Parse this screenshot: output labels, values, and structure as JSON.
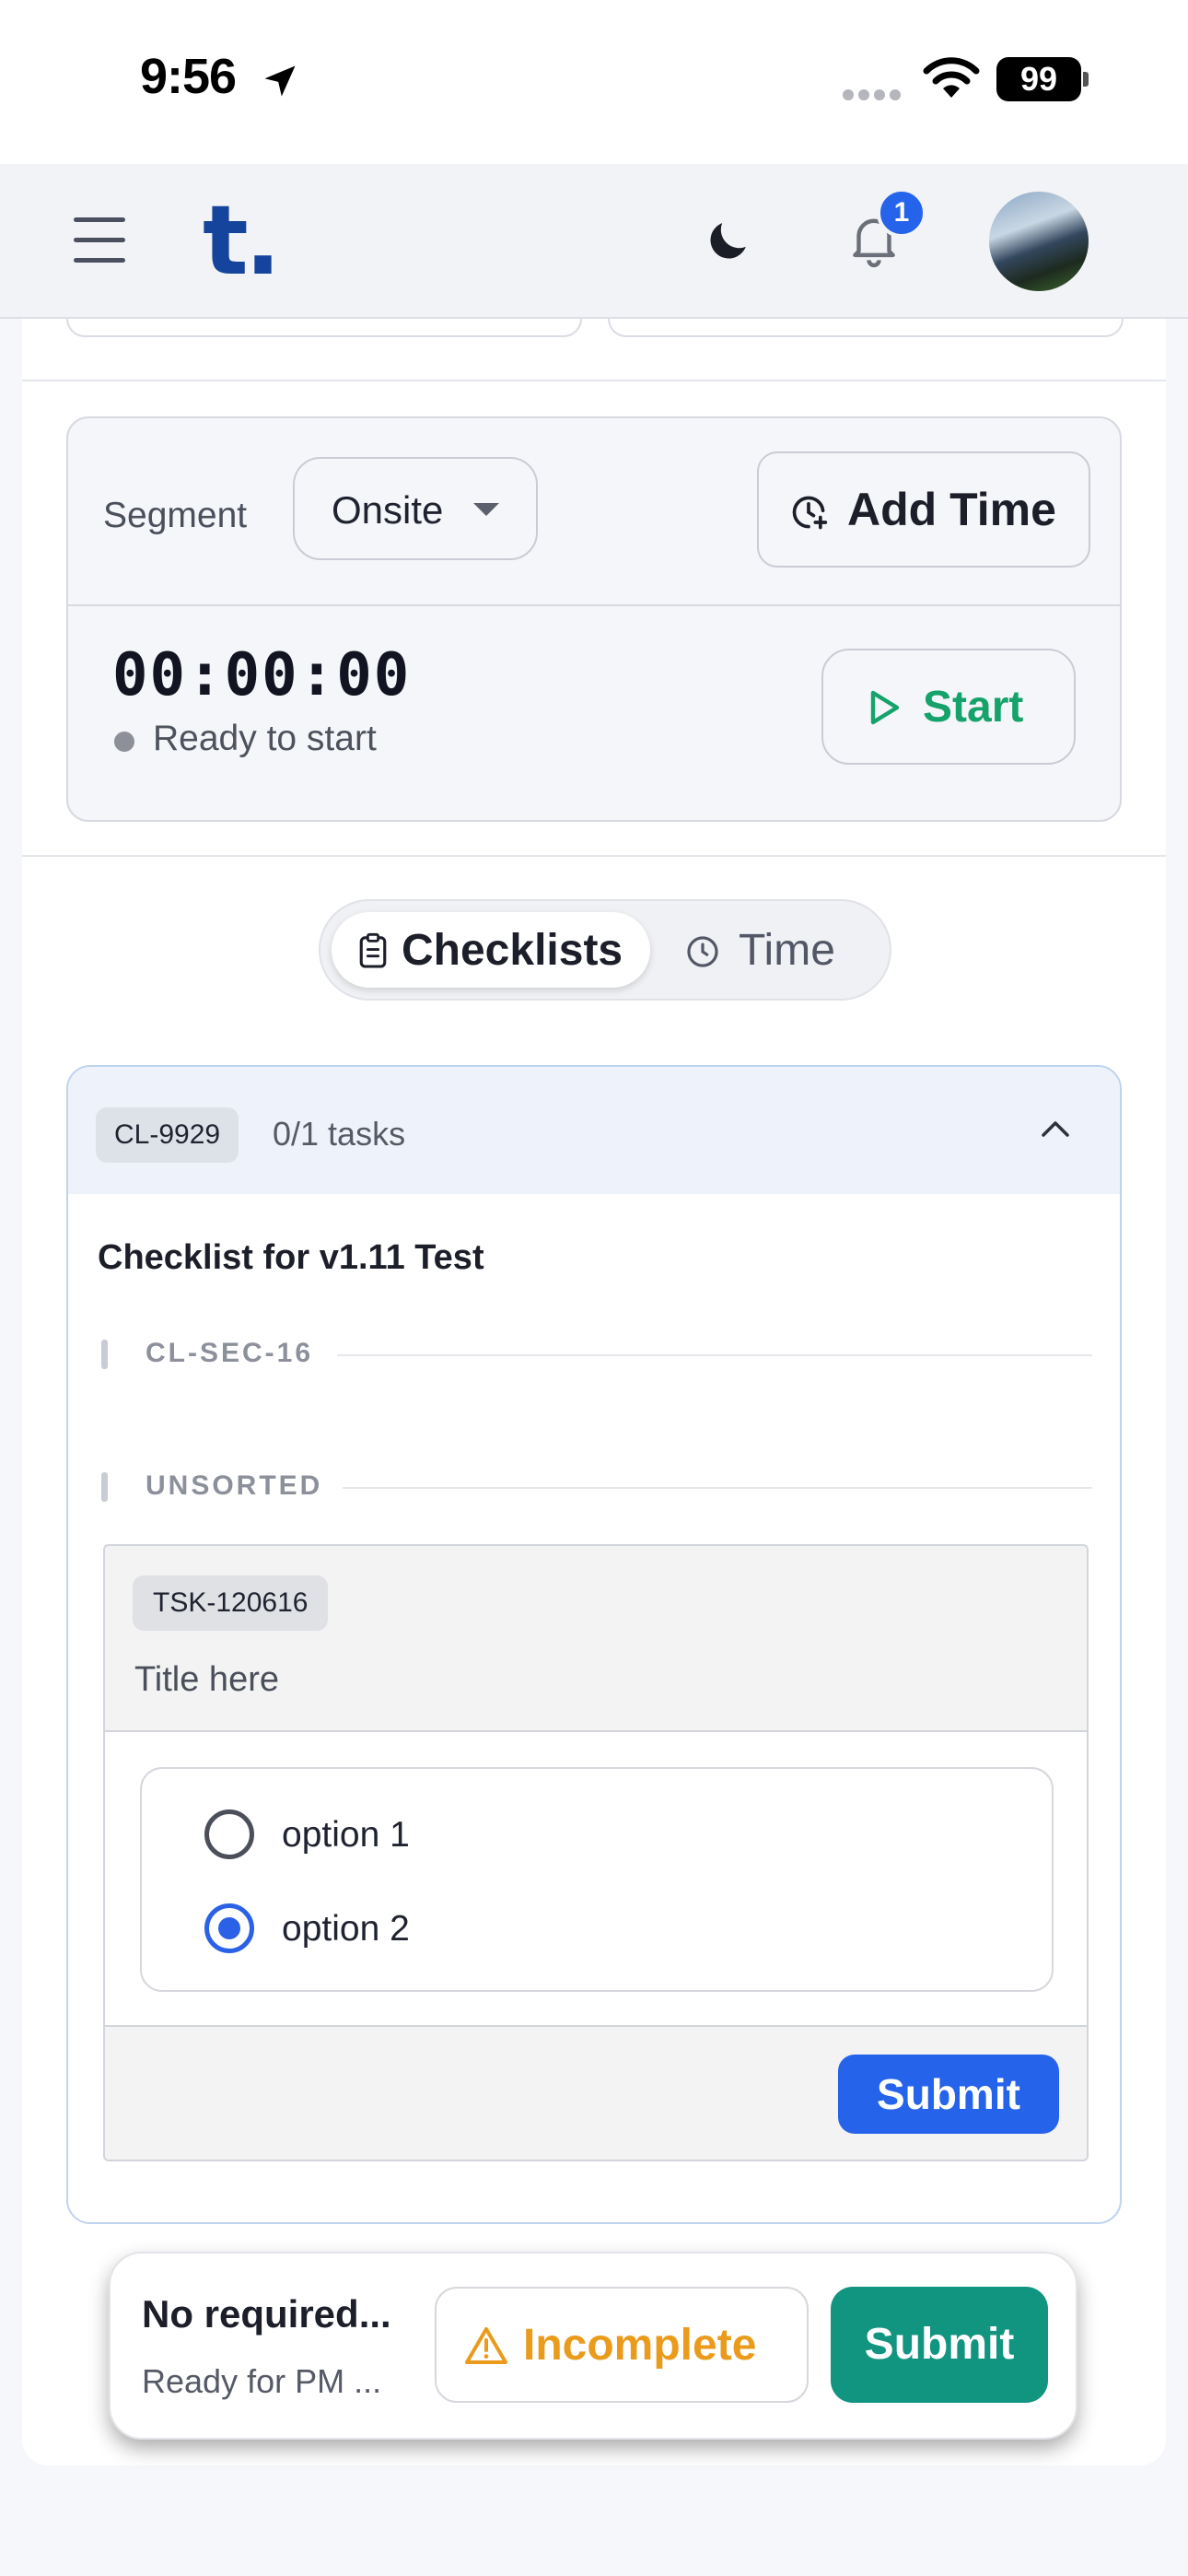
{
  "status_bar": {
    "time": "9:56",
    "battery": "99",
    "icons": [
      "location-arrow-icon",
      "signal-dots-icon",
      "wifi-icon",
      "battery-icon"
    ]
  },
  "app_bar": {
    "logo": "t.",
    "notification_count": "1",
    "icons": [
      "hamburger-menu-icon",
      "moon-icon",
      "bell-icon"
    ]
  },
  "timer": {
    "segment_label": "Segment",
    "segment_value": "Onsite",
    "add_time_label": "Add Time",
    "elapsed": "00:00:00",
    "status": "Ready to start",
    "start_label": "Start"
  },
  "tabs": [
    {
      "label": "Checklists",
      "icon": "clipboard-icon",
      "active": true
    },
    {
      "label": "Time",
      "icon": "clock-icon",
      "active": false
    }
  ],
  "checklist": {
    "id": "CL-9929",
    "progress": "0/1 tasks",
    "title": "Checklist for v1.11 Test",
    "sections": [
      "CL-SEC-16",
      "UNSORTED"
    ],
    "task": {
      "id": "TSK-120616",
      "title": "Title here",
      "options": [
        {
          "label": "option 1",
          "selected": false
        },
        {
          "label": "option 2",
          "selected": true
        }
      ],
      "submit_label": "Submit"
    }
  },
  "bottom_bar": {
    "title": "No required...",
    "subtitle": "Ready for PM ...",
    "incomplete_label": "Incomplete",
    "submit_label": "Submit"
  },
  "colors": {
    "brand": "#15449c",
    "primary": "#2563eb",
    "start_green": "#16a36b",
    "submit_teal": "#119580",
    "warning": "#eb9b1c"
  }
}
